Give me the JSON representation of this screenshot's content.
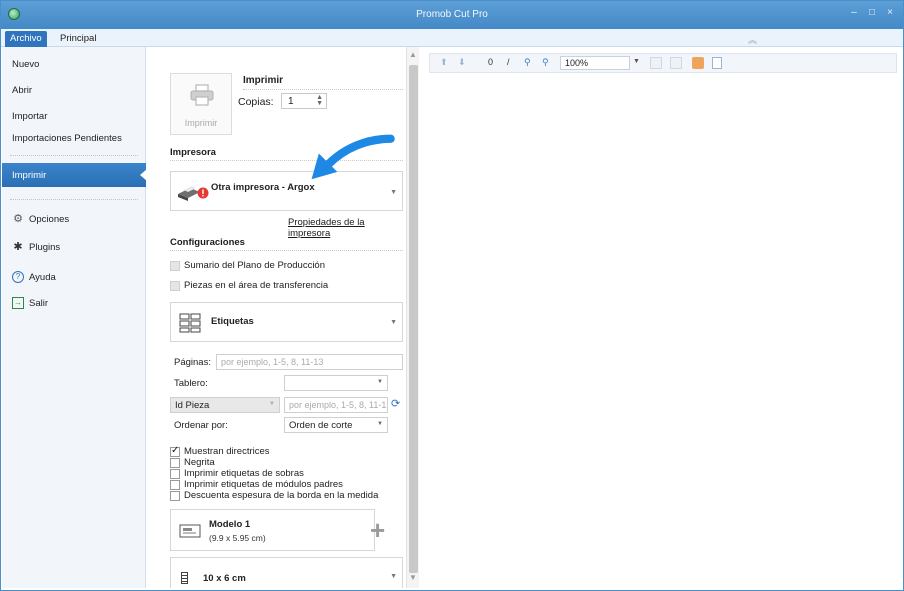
{
  "window": {
    "title": "Promob Cut Pro",
    "controls": [
      "–",
      "□",
      "×"
    ]
  },
  "menu": {
    "tabs": [
      {
        "label": "Archivo",
        "active": true
      },
      {
        "label": "Principal",
        "active": false
      }
    ],
    "collapse_glyph": "︽"
  },
  "sidebar": {
    "items": [
      {
        "label": "Nuevo"
      },
      {
        "label": "Abrir"
      },
      {
        "label": "Importar"
      },
      {
        "label": "Importaciones Pendientes"
      }
    ],
    "active_item": "Imprimir",
    "bottom_items": [
      {
        "label": "Opciones",
        "icon": "gear-icon"
      },
      {
        "label": "Plugins",
        "icon": "puzzle-icon"
      },
      {
        "label": "Ayuda",
        "icon": "help-icon"
      },
      {
        "label": "Salir",
        "icon": "exit-icon"
      }
    ]
  },
  "print": {
    "button_label": "Imprimir",
    "title": "Imprimir",
    "copies_label": "Copias:",
    "copies_value": "1"
  },
  "printer": {
    "section_title": "Impresora",
    "selected": "Otra impresora - Argox",
    "properties_link": "Propiedades de la impresora"
  },
  "config": {
    "section_title": "Configuraciones",
    "options": [
      {
        "label": "Sumario del Plano de Producción",
        "checked": false,
        "disabled": true
      },
      {
        "label": "Piezas en el área de transferencia",
        "checked": false,
        "disabled": true
      }
    ],
    "type_selected": "Etiquetas",
    "pages_label": "Páginas:",
    "pages_placeholder": "por ejemplo, 1-5, 8, 11-13",
    "board_label": "Tablero:",
    "board_value": "",
    "id_select": "Id Pieza",
    "id_placeholder": "por ejemplo, 1-5, 8, 11-13",
    "order_label": "Ordenar por:",
    "order_value": "Orden de corte",
    "checkboxes": [
      {
        "label": "Muestran directrices",
        "checked": true
      },
      {
        "label": "Negrita",
        "checked": false
      },
      {
        "label": "Imprimir etiquetas de sobras",
        "checked": false
      },
      {
        "label": "Imprimir etiquetas de módulos padres",
        "checked": false
      },
      {
        "label": "Descuenta espesura de la borda en la medida",
        "checked": false
      }
    ],
    "model_name": "Modelo 1",
    "model_size": "(9.9 x 5.95 cm)",
    "label_size": "10 x 6 cm"
  },
  "preview_toolbar": {
    "page_value": "0",
    "page_sep": "/",
    "zoom_value": "100%"
  },
  "colors": {
    "titlebar": "#4a90c8",
    "accent": "#2f74bd",
    "arrow": "#1e88e5"
  }
}
